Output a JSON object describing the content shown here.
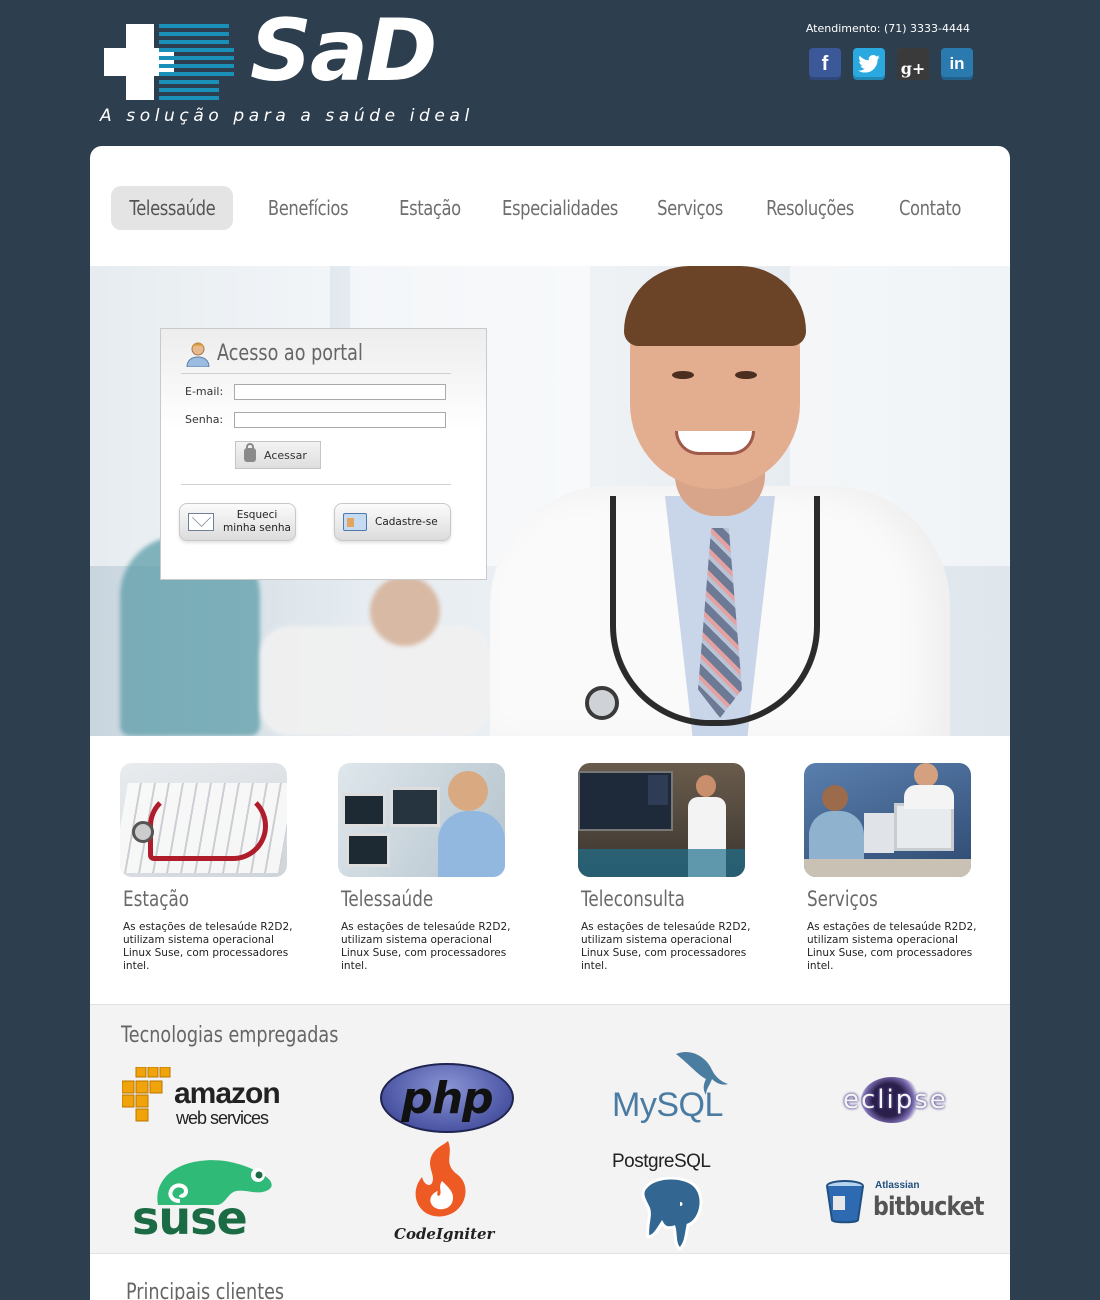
{
  "brand": {
    "name": "SaD",
    "tagline": "A solução para a saúde ideal"
  },
  "contact": {
    "atendimento": "Atendimento: (71) 3333-4444"
  },
  "social": [
    {
      "name": "facebook",
      "label": "f",
      "color": "#3b5998"
    },
    {
      "name": "twitter",
      "label": "t",
      "color": "#2aa9e0"
    },
    {
      "name": "google-plus",
      "label": "g+",
      "color": "#3d3d3d"
    },
    {
      "name": "linkedin",
      "label": "in",
      "color": "#2a7ab0"
    }
  ],
  "nav": {
    "items": [
      {
        "label": "Telessaúde",
        "active": true
      },
      {
        "label": "Benefícios",
        "active": false
      },
      {
        "label": "Estação",
        "active": false
      },
      {
        "label": "Especialidades",
        "active": false
      },
      {
        "label": "Serviços",
        "active": false
      },
      {
        "label": "Resoluções",
        "active": false
      },
      {
        "label": "Contato",
        "active": false
      }
    ]
  },
  "login": {
    "title": "Acesso ao portal",
    "email_label": "E-mail:",
    "email_value": "",
    "senha_label": "Senha:",
    "senha_value": "",
    "submit_label": "Acessar",
    "forgot_label": "Esqueci minha senha",
    "register_label": "Cadastre-se"
  },
  "features": [
    {
      "title": "Estação",
      "text": "As estações de telesaúde R2D2, utilizam sistema operacional Linux Suse, com processadores intel."
    },
    {
      "title": "Telessaúde",
      "text": "As estações de telesaúde R2D2, utilizam sistema operacional Linux Suse, com processadores intel."
    },
    {
      "title": "Teleconsulta",
      "text": "As estações de telesaúde R2D2, utilizam sistema operacional Linux Suse, com processadores intel."
    },
    {
      "title": "Serviços",
      "text": "As estações de telesaúde R2D2, utilizam sistema operacional Linux Suse, com processadores intel."
    }
  ],
  "tech": {
    "title": "Tecnologias empregadas",
    "logos": {
      "amazon_main": "amazon",
      "amazon_sub": "web services",
      "php": "php",
      "mysql": "MySQL",
      "eclipse": "eclipse",
      "suse": "suse",
      "codeigniter": "CodeIgniter",
      "postgresql": "PostgreSQL",
      "bitbucket_top": "Atlassian",
      "bitbucket": "bitbucket"
    }
  },
  "clients": {
    "title": "Principais clientes"
  },
  "colors": {
    "background": "#2d3e4f",
    "panel": "#ffffff",
    "nav_active": "#e4e4e4"
  }
}
